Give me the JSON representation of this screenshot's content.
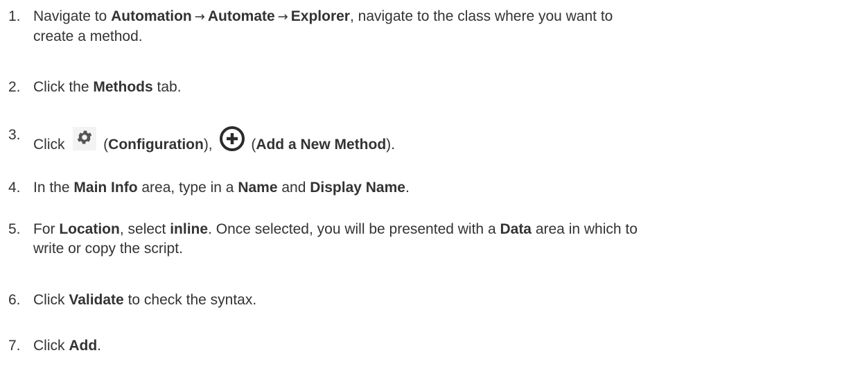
{
  "steps": [
    {
      "number": "1.",
      "parts": {
        "a": "Navigate to ",
        "b1": "Automation",
        "arrow1": "→",
        "b2": "Automate",
        "arrow2": "→",
        "b3": "Explorer",
        "c": ", navigate to the class where you want to",
        "d": "create a method."
      }
    },
    {
      "number": "2.",
      "parts": {
        "a": "Click the ",
        "b1": "Methods",
        "c": " tab."
      }
    },
    {
      "number": "3.",
      "parts": {
        "a": "Click ",
        "icon1": "gear-icon",
        "p1": " (",
        "b1": "Configuration",
        "p2": "), ",
        "icon2": "plus-circle-icon",
        "p3": " (",
        "b2": "Add a New Method",
        "p4": ")."
      }
    },
    {
      "number": "4.",
      "parts": {
        "a": "In the ",
        "b1": "Main Info",
        "c": " area, type in a ",
        "b2": "Name",
        "d": " and ",
        "b3": "Display Name",
        "e": "."
      }
    },
    {
      "number": "5.",
      "parts": {
        "a": "For ",
        "b1": "Location",
        "c": ", select ",
        "b2": "inline",
        "d": ". Once selected, you will be presented with a ",
        "b3": "Data",
        "e": " area in which to",
        "f": "write or copy the script."
      }
    },
    {
      "number": "6.",
      "parts": {
        "a": "Click ",
        "b1": "Validate",
        "c": " to check the syntax."
      }
    },
    {
      "number": "7.",
      "parts": {
        "a": "Click ",
        "b1": "Add",
        "c": "."
      }
    }
  ],
  "colors": {
    "text": "#333333",
    "icon_gear": "#555555",
    "icon_plus": "#2b2b2b",
    "background": "#ffffff"
  }
}
